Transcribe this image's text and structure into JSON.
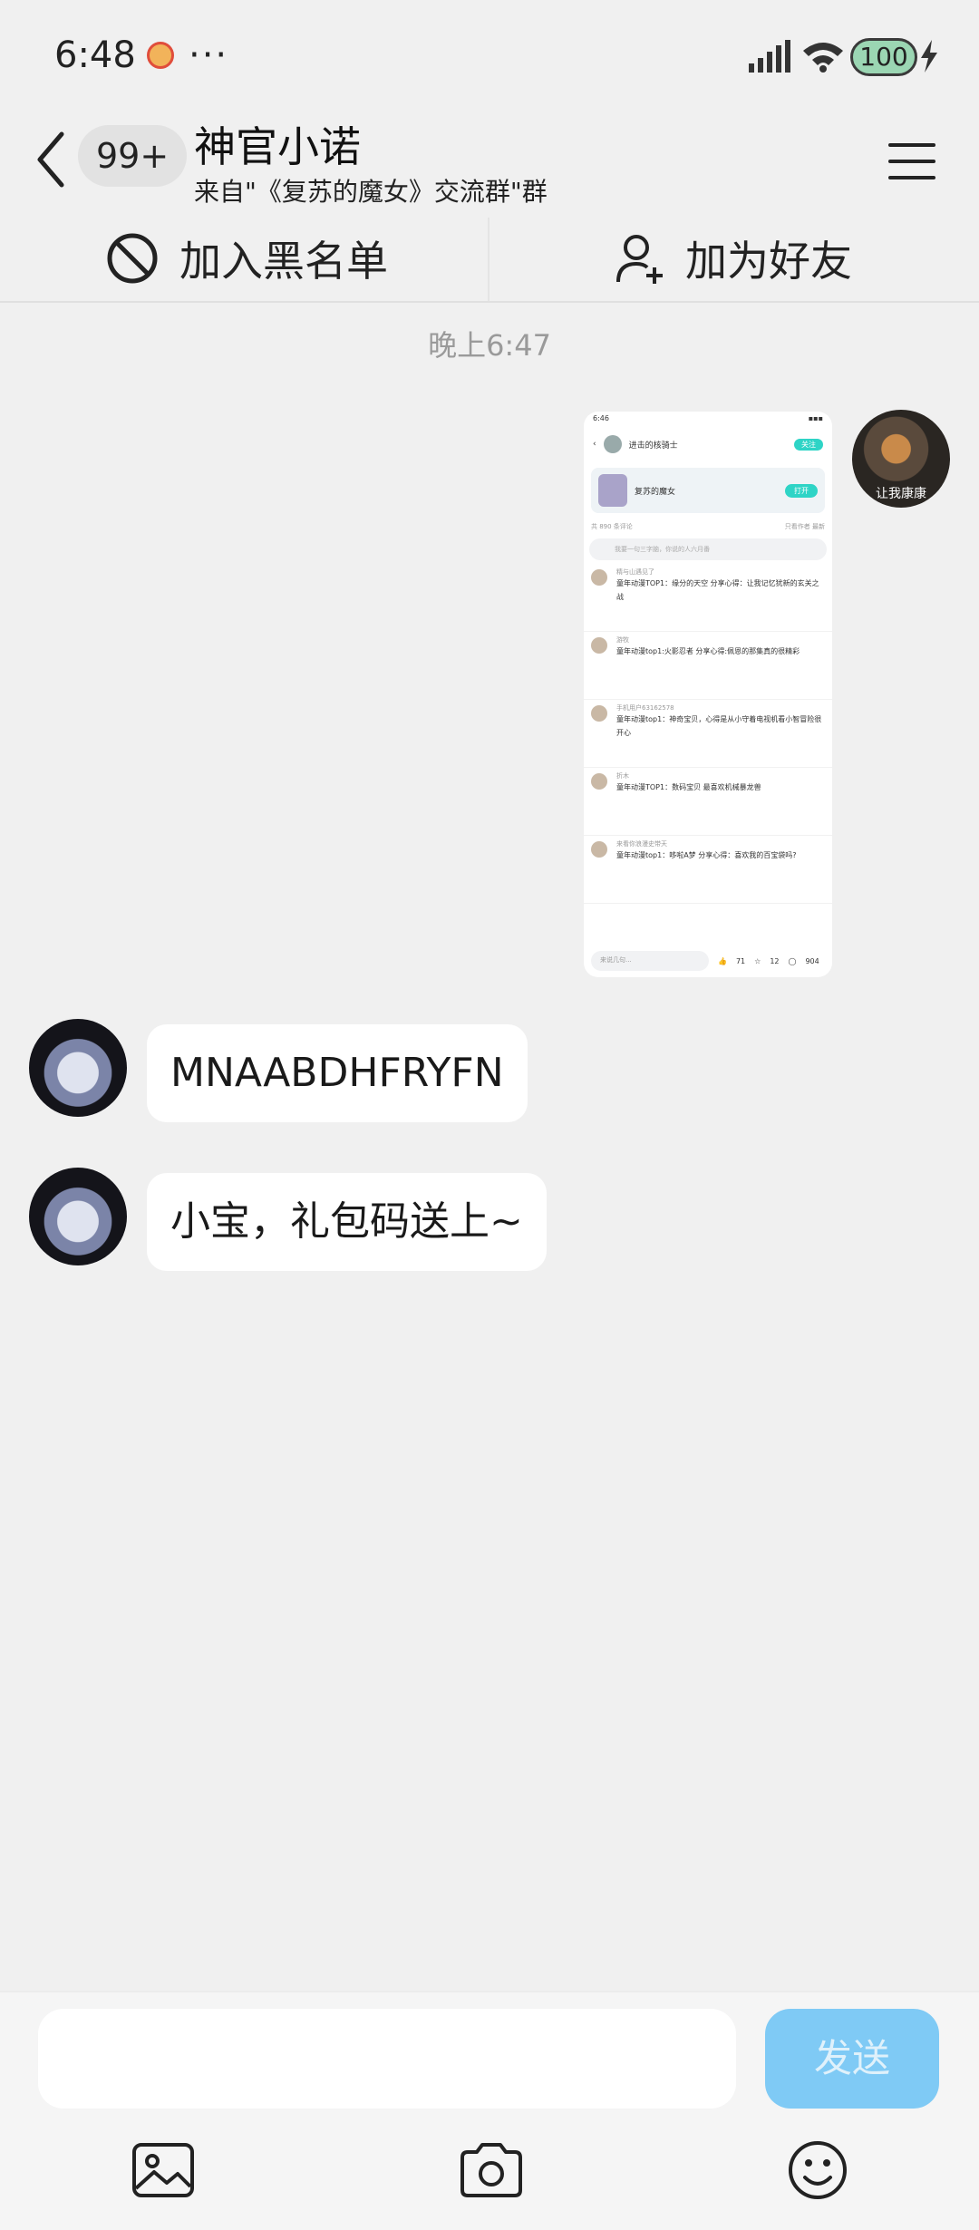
{
  "status_bar": {
    "time": "6:48",
    "dots": "···",
    "battery": "100"
  },
  "header": {
    "badge": "99+",
    "title": "神官小诺",
    "subtitle": "来自\"《复苏的魔女》交流群\"群"
  },
  "actions": {
    "blacklist_label": "加入黑名单",
    "add_friend_label": "加为好友"
  },
  "chat": {
    "timestamp": "晚上6:47",
    "self_avatar_caption": "让我康康",
    "messages": [
      {
        "text": "MNAABDHFRYFN"
      },
      {
        "text": "小宝，礼包码送上~"
      }
    ]
  },
  "shared_screenshot": {
    "time": "6:46",
    "author": "进击的核骑士",
    "follow": "关注",
    "card_title": "复苏的魔女",
    "card_button": "打开",
    "comment_count": "共 890 条评论",
    "filter_label": "只看作者",
    "sort_label": "最新",
    "search_placeholder": "我要一句三字脑，你说的人六月番",
    "comments": [
      {
        "name": "精与山遇见了",
        "text": "童年动漫TOP1：缘分的天空 分享心得：让我记忆犹新的玄关之战"
      },
      {
        "name": "游牧",
        "text": "童年动漫top1:火影忍者 分享心得:佩恩的那集真的很精彩"
      },
      {
        "name": "手机用户63162578",
        "text": "童年动漫top1：神奇宝贝，心得是从小守着电视机看小智冒险很开心"
      },
      {
        "name": "折木",
        "text": "童年动漫TOP1：数码宝贝 最喜欢机械暴龙兽"
      },
      {
        "name": "来看你浪漫史带天",
        "text": "童年动漫top1：哆啦A梦 分享心得：喜欢我的百宝袋吗?"
      }
    ],
    "input_placeholder": "来说几句...",
    "likes": "71",
    "stars": "12",
    "replies": "904"
  },
  "input_bar": {
    "placeholder": "",
    "send_label": "发送"
  },
  "colors": {
    "send_button": "#7fcaf5",
    "accent": "#2ed4c6"
  }
}
